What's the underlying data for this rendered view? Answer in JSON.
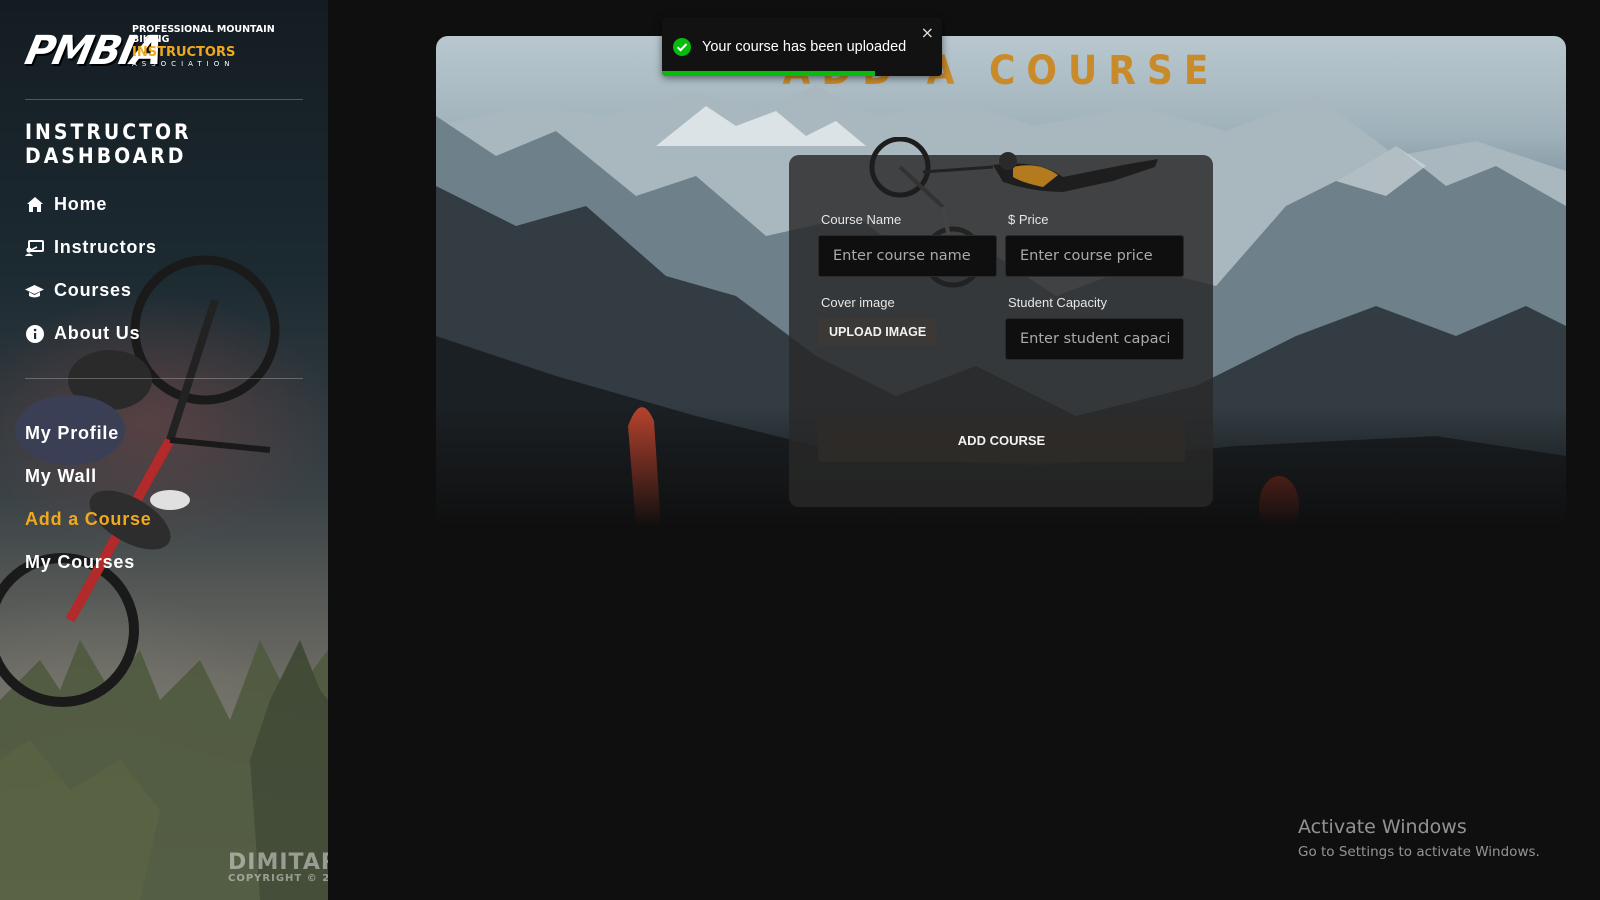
{
  "sidebar": {
    "logo": {
      "mark": "PMBIA",
      "line1": "PROFESSIONAL MOUNTAIN BIKING",
      "line2": "INSTRUCTORS",
      "line3": "ASSOCIATION"
    },
    "title": "INSTRUCTOR DASHBOARD",
    "primary_nav": [
      {
        "label": "Home",
        "icon": "home-icon"
      },
      {
        "label": "Instructors",
        "icon": "instructor-icon"
      },
      {
        "label": "Courses",
        "icon": "graduation-cap-icon"
      },
      {
        "label": "About Us",
        "icon": "info-icon"
      }
    ],
    "secondary_nav": [
      {
        "label": "My Profile",
        "active": false
      },
      {
        "label": "My Wall",
        "active": false
      },
      {
        "label": "Add a Course",
        "active": true
      },
      {
        "label": "My Courses",
        "active": false
      }
    ],
    "photo_watermark": {
      "line1": "DIMITAR",
      "line2": "COPYRIGHT © 2"
    },
    "accent_color": "#f0a91d"
  },
  "main": {
    "title": "ADD A COURSE",
    "form": {
      "course_name_label": "Course Name",
      "course_name_placeholder": "Enter course name",
      "price_label": "$ Price",
      "price_placeholder": "Enter course price",
      "cover_label": "Cover image",
      "upload_label": "UPLOAD IMAGE",
      "capacity_label": "Student Capacity",
      "capacity_placeholder": "Enter student capacity",
      "submit_label": "ADD COURSE"
    }
  },
  "toast": {
    "message": "Your course has been uploaded",
    "close_glyph": "×",
    "status_color": "#07bc0c",
    "progress": 0.76
  },
  "os_overlay": {
    "line1": "Activate Windows",
    "line2": "Go to Settings to activate Windows."
  }
}
